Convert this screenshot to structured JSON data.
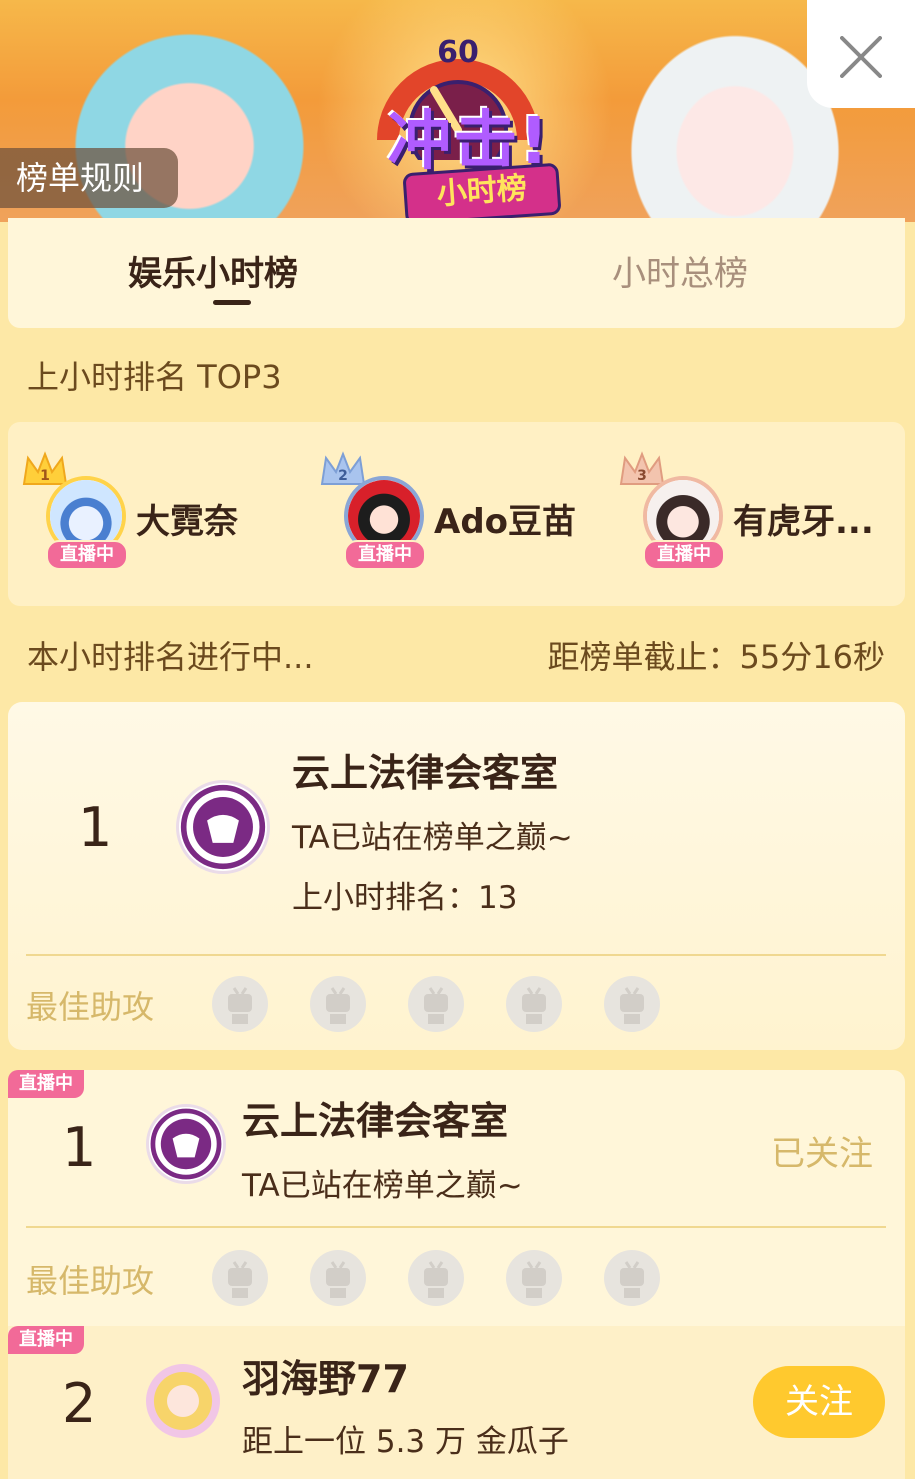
{
  "banner": {
    "logo_main": "冲击!",
    "logo_sub": "小时榜",
    "gauge_value": "60",
    "rules_label": "榜单规则"
  },
  "tabs": [
    {
      "label": "娱乐小时榜",
      "active": true
    },
    {
      "label": "小时总榜",
      "active": false
    }
  ],
  "last_hour": {
    "title": "上小时排名 TOP3",
    "items": [
      {
        "rank": "1",
        "name": "大霓奈",
        "live": "直播中"
      },
      {
        "rank": "2",
        "name": "Ado豆苗",
        "live": "直播中"
      },
      {
        "rank": "3",
        "name": "有虎牙...",
        "live": "直播中"
      }
    ]
  },
  "status": {
    "progress": "本小时排名进行中...",
    "countdown": "距榜单截止：55分16秒"
  },
  "my_card": {
    "rank": "1",
    "name": "云上法律会客室",
    "desc": "TA已站在榜单之巅~",
    "last_rank": "上小时排名：13",
    "assist_label": "最佳助攻"
  },
  "list": [
    {
      "live": "直播中",
      "rank": "1",
      "name": "云上法律会客室",
      "desc": "TA已站在榜单之巅~",
      "follow_state": "已关注",
      "assist_label": "最佳助攻"
    },
    {
      "live": "直播中",
      "rank": "2",
      "name": "羽海野77",
      "desc": "距上一位 5.3 万 金瓜子",
      "follow_state": "关注"
    }
  ],
  "colors": {
    "background": "#fde8a6",
    "live_tag": "#f26a98",
    "follow_button": "#ffc92e",
    "muted_gold": "#d6b86a"
  },
  "icons": {
    "close": "close-icon",
    "crown": "crown-icon",
    "assist_placeholder": "tv-placeholder-icon"
  }
}
